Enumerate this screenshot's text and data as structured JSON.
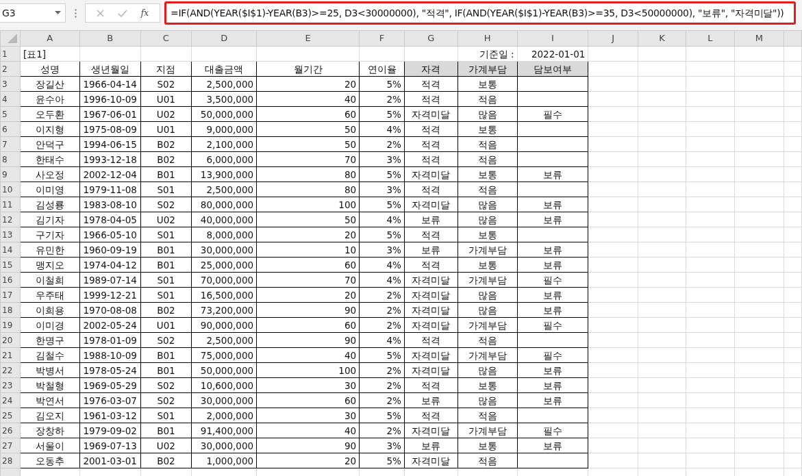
{
  "name_box": "G3",
  "function_label": "fx",
  "formula": "=IF(AND(YEAR($I$1)-YEAR(B3)>=25, D3<30000000), \"적격\", IF(AND(YEAR($I$1)-YEAR(B3)>=35, D3<50000000), \"보류\", \"자격미달\"))",
  "column_letters": [
    "A",
    "B",
    "C",
    "D",
    "E",
    "F",
    "G",
    "H",
    "I",
    "J",
    "K",
    "L",
    "M"
  ],
  "title_row": {
    "row": "1",
    "title": "[표1]",
    "date_label": "기준일 :",
    "date": "2022-01-01"
  },
  "header_row": {
    "row": "2",
    "headers": [
      {
        "text": "성명",
        "shaded": false
      },
      {
        "text": "생년월일",
        "shaded": false
      },
      {
        "text": "지점",
        "shaded": false
      },
      {
        "text": "대출금액",
        "shaded": false
      },
      {
        "text": "월기간",
        "shaded": false
      },
      {
        "text": "연이율",
        "shaded": false
      },
      {
        "text": "자격",
        "shaded": true
      },
      {
        "text": "가계부담",
        "shaded": true
      },
      {
        "text": "담보여부",
        "shaded": true
      }
    ]
  },
  "rows": [
    {
      "row": "3",
      "name": "장길산",
      "birth": "1966-04-14",
      "branch": "S02",
      "amount": "2,500,000",
      "months": "20",
      "rate": "5%",
      "status": "적격",
      "burden": "보통"
    },
    {
      "row": "4",
      "name": "윤수아",
      "birth": "1996-10-09",
      "branch": "U01",
      "amount": "3,500,000",
      "months": "40",
      "rate": "2%",
      "status": "적격",
      "burden": "적음"
    },
    {
      "row": "5",
      "name": "오두환",
      "birth": "1967-06-01",
      "branch": "U02",
      "amount": "50,000,000",
      "months": "60",
      "rate": "5%",
      "status": "자격미달",
      "burden": "많음",
      "collateral": "필수"
    },
    {
      "row": "6",
      "name": "이지형",
      "birth": "1975-08-09",
      "branch": "U01",
      "amount": "9,000,000",
      "months": "50",
      "rate": "4%",
      "status": "적격",
      "burden": "보통"
    },
    {
      "row": "7",
      "name": "안덕구",
      "birth": "1994-06-15",
      "branch": "B02",
      "amount": "2,100,000",
      "months": "50",
      "rate": "2%",
      "status": "적격",
      "burden": "적음"
    },
    {
      "row": "8",
      "name": "한태수",
      "birth": "1993-12-18",
      "branch": "B02",
      "amount": "6,000,000",
      "months": "70",
      "rate": "3%",
      "status": "적격",
      "burden": "적음"
    },
    {
      "row": "9",
      "name": "사오정",
      "birth": "2002-12-04",
      "branch": "B01",
      "amount": "13,900,000",
      "months": "80",
      "rate": "5%",
      "status": "자격미달",
      "burden": "보통",
      "collateral": "보류"
    },
    {
      "row": "10",
      "name": "이미영",
      "birth": "1979-11-08",
      "branch": "S01",
      "amount": "2,500,000",
      "months": "80",
      "rate": "3%",
      "status": "적격",
      "burden": "적음"
    },
    {
      "row": "11",
      "name": "김성룡",
      "birth": "1983-08-10",
      "branch": "S02",
      "amount": "80,000,000",
      "months": "100",
      "rate": "5%",
      "status": "자격미달",
      "burden": "많음",
      "collateral": "보류"
    },
    {
      "row": "12",
      "name": "김기자",
      "birth": "1978-04-05",
      "branch": "U02",
      "amount": "40,000,000",
      "months": "50",
      "rate": "4%",
      "status": "보류",
      "burden": "많음",
      "collateral": "보류"
    },
    {
      "row": "13",
      "name": "구기자",
      "birth": "1966-05-10",
      "branch": "S01",
      "amount": "8,000,000",
      "months": "20",
      "rate": "5%",
      "status": "적격",
      "burden": "보통"
    },
    {
      "row": "14",
      "name": "유민한",
      "birth": "1960-09-19",
      "branch": "B01",
      "amount": "30,000,000",
      "months": "10",
      "rate": "3%",
      "status": "보류",
      "burden": "가계부담",
      "collateral": "보류"
    },
    {
      "row": "15",
      "name": "맹지오",
      "birth": "1974-04-12",
      "branch": "B01",
      "amount": "25,000,000",
      "months": "60",
      "rate": "4%",
      "status": "적격",
      "burden": "보통",
      "collateral": "보류"
    },
    {
      "row": "16",
      "name": "이철희",
      "birth": "1989-07-14",
      "branch": "S01",
      "amount": "70,000,000",
      "months": "70",
      "rate": "4%",
      "status": "자격미달",
      "burden": "가계부담",
      "collateral": "필수"
    },
    {
      "row": "17",
      "name": "우주태",
      "birth": "1999-12-21",
      "branch": "S01",
      "amount": "16,500,000",
      "months": "20",
      "rate": "2%",
      "status": "자격미달",
      "burden": "많음",
      "collateral": "보류"
    },
    {
      "row": "18",
      "name": "이희용",
      "birth": "1970-08-08",
      "branch": "B02",
      "amount": "73,200,000",
      "months": "90",
      "rate": "2%",
      "status": "자격미달",
      "burden": "많음",
      "collateral": "보류"
    },
    {
      "row": "19",
      "name": "이미경",
      "birth": "2002-05-24",
      "branch": "U01",
      "amount": "90,000,000",
      "months": "60",
      "rate": "2%",
      "status": "자격미달",
      "burden": "가계부담",
      "collateral": "필수"
    },
    {
      "row": "20",
      "name": "한명구",
      "birth": "1978-01-09",
      "branch": "S02",
      "amount": "2,500,000",
      "months": "90",
      "rate": "4%",
      "status": "적격",
      "burden": "적음"
    },
    {
      "row": "21",
      "name": "김철수",
      "birth": "1988-10-09",
      "branch": "B01",
      "amount": "75,000,000",
      "months": "40",
      "rate": "5%",
      "status": "자격미달",
      "burden": "가계부담",
      "collateral": "필수"
    },
    {
      "row": "22",
      "name": "박병서",
      "birth": "1978-05-24",
      "branch": "B01",
      "amount": "50,000,000",
      "months": "100",
      "rate": "2%",
      "status": "자격미달",
      "burden": "많음",
      "collateral": "보류"
    },
    {
      "row": "23",
      "name": "박철형",
      "birth": "1969-05-29",
      "branch": "S02",
      "amount": "10,600,000",
      "months": "30",
      "rate": "2%",
      "status": "적격",
      "burden": "보통",
      "collateral": "보류"
    },
    {
      "row": "24",
      "name": "박연서",
      "birth": "1976-03-07",
      "branch": "S02",
      "amount": "30,000,000",
      "months": "60",
      "rate": "2%",
      "status": "보류",
      "burden": "많음",
      "collateral": "보류"
    },
    {
      "row": "25",
      "name": "김오지",
      "birth": "1961-03-12",
      "branch": "S01",
      "amount": "2,000,000",
      "months": "30",
      "rate": "5%",
      "status": "적격",
      "burden": "적음"
    },
    {
      "row": "26",
      "name": "장창하",
      "birth": "1979-09-02",
      "branch": "B01",
      "amount": "91,400,000",
      "months": "40",
      "rate": "2%",
      "status": "자격미달",
      "burden": "가계부담",
      "collateral": "필수"
    },
    {
      "row": "27",
      "name": "서울이",
      "birth": "1969-07-13",
      "branch": "U02",
      "amount": "30,000,000",
      "months": "90",
      "rate": "3%",
      "status": "보류",
      "burden": "보통",
      "collateral": "보류"
    },
    {
      "row": "28",
      "name": "오동추",
      "birth": "2001-03-01",
      "branch": "B02",
      "amount": "1,000,000",
      "months": "20",
      "rate": "5%",
      "status": "자격미달",
      "burden": "적음"
    }
  ]
}
